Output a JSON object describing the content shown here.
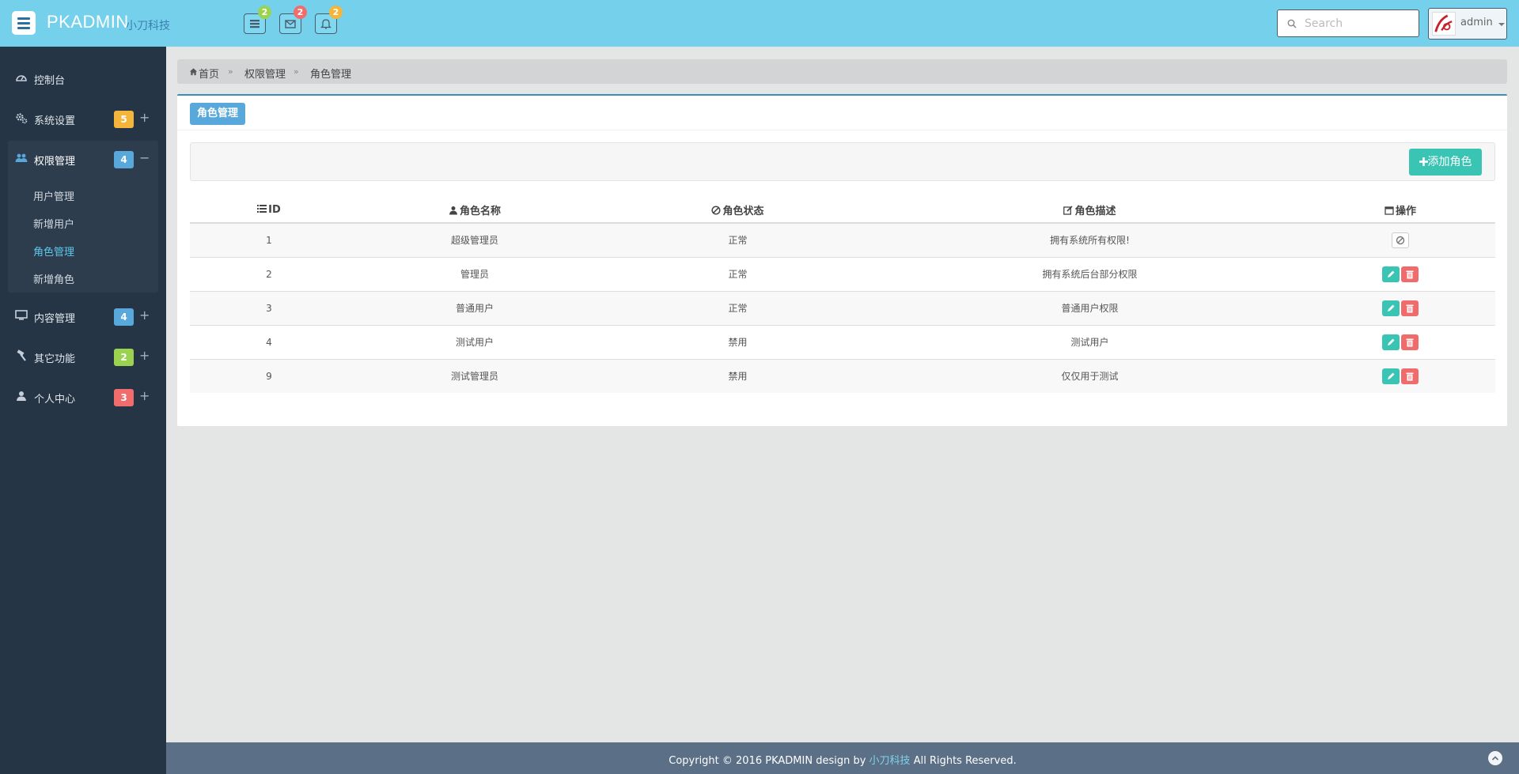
{
  "app": {
    "brand": "PKADMIN",
    "brand_sub": "小刀科技"
  },
  "topbar": {
    "icons": [
      {
        "icon": "list-icon",
        "badge": "2",
        "badge_color": "#9bd24f"
      },
      {
        "icon": "envelope-icon",
        "badge": "2",
        "badge_color": "#f16c6c"
      },
      {
        "icon": "bell-icon",
        "badge": "2",
        "badge_color": "#f5b53a"
      }
    ],
    "search_placeholder": "Search",
    "user": "admin"
  },
  "sidebar": {
    "items": [
      {
        "label": "控制台",
        "icon": "dashboard-icon"
      },
      {
        "label": "系统设置",
        "icon": "gears-icon",
        "badge": "5",
        "badge_color": "#f5b53a",
        "toggle": "+"
      },
      {
        "label": "权限管理",
        "icon": "users-icon",
        "badge": "4",
        "badge_color": "#58a8dc",
        "toggle": "−"
      },
      {
        "label": "内容管理",
        "icon": "monitor-icon",
        "badge": "4",
        "badge_color": "#58a8dc",
        "toggle": "+"
      },
      {
        "label": "其它功能",
        "icon": "hammer-icon",
        "badge": "2",
        "badge_color": "#9bd24f",
        "toggle": "+"
      },
      {
        "label": "个人中心",
        "icon": "user-icon",
        "badge": "3",
        "badge_color": "#f16c6c",
        "toggle": "+"
      }
    ],
    "sub_items": [
      "用户管理",
      "新增用户",
      "角色管理",
      "新增角色"
    ],
    "active_sub": "角色管理"
  },
  "breadcrumb": {
    "home": "首页",
    "level1": "权限管理",
    "level2": "角色管理",
    "sep": "»"
  },
  "panel": {
    "title": "角色管理",
    "add_button": "添加角色",
    "columns": [
      "ID",
      "角色名称",
      "角色状态",
      "角色描述",
      "操作"
    ],
    "rows": [
      {
        "id": "1",
        "name": "超级管理员",
        "status": "正常",
        "desc": "拥有系统所有权限!",
        "actions": "disable"
      },
      {
        "id": "2",
        "name": "管理员",
        "status": "正常",
        "desc": "拥有系统后台部分权限",
        "actions": "edit-delete"
      },
      {
        "id": "3",
        "name": "普通用户",
        "status": "正常",
        "desc": "普通用户权限",
        "actions": "edit-delete"
      },
      {
        "id": "4",
        "name": "测试用户",
        "status": "禁用",
        "desc": "测试用户",
        "actions": "edit-delete"
      },
      {
        "id": "9",
        "name": "测试管理员",
        "status": "禁用",
        "desc": "仅仅用于测试",
        "actions": "edit-delete"
      }
    ]
  },
  "footer": {
    "prefix": "Copyright © 2016 PKADMIN design by",
    "brand": "小刀科技",
    "suffix": "All Rights Reserved."
  }
}
